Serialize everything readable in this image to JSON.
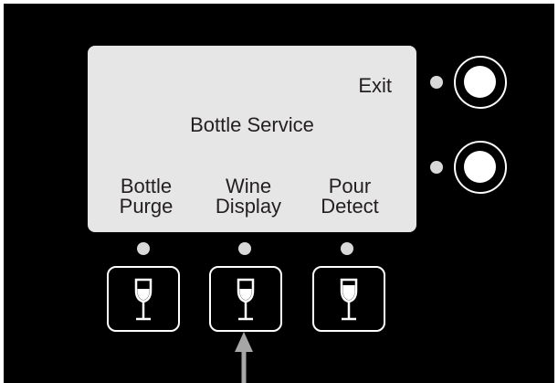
{
  "screen": {
    "exit_label": "Exit",
    "title": "Bottle Service",
    "softkeys": [
      {
        "line1": "Bottle",
        "line2": "Purge"
      },
      {
        "line1": "Wine",
        "line2": "Display"
      },
      {
        "line1": "Pour",
        "line2": "Detect"
      }
    ]
  },
  "icons": {
    "softkey_icon": "wine-glass-icon",
    "side_button_icon": "round-button",
    "pointer": "up-arrow"
  },
  "colors": {
    "panel": "#000000",
    "screen": "#e6e6e6",
    "text": "#231f20",
    "led": "#d9d9d9",
    "arrow": "#a6a6a6",
    "button_outline": "#ffffff"
  }
}
